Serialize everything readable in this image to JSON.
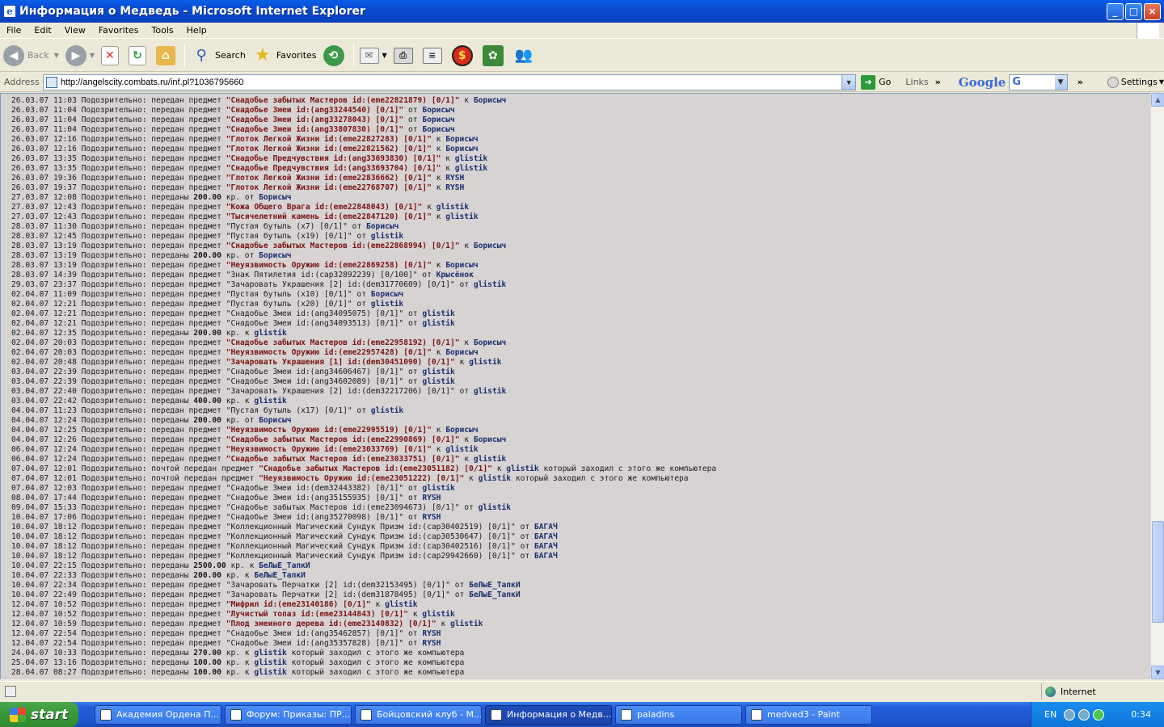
{
  "window": {
    "title": "Информация о Медведь - Microsoft Internet Explorer",
    "controls": [
      "_",
      "□",
      "×"
    ]
  },
  "menu": [
    "File",
    "Edit",
    "View",
    "Favorites",
    "Tools",
    "Help"
  ],
  "toolbar": {
    "back": "Back",
    "search": "Search",
    "favorites": "Favorites"
  },
  "address": {
    "label": "Address",
    "url": "http://angelscity.combats.ru/inf.pl?1036795660",
    "go": "Go",
    "links": "Links",
    "google": "Google",
    "google_select": "G",
    "settings": "Settings"
  },
  "log": [
    [
      [
        "26.03.07 11:03 Подозрительно: передан предмет ",
        "t"
      ],
      [
        "\"Снадобье забытых Мастеров id:(eme22821879) [0/1]\"",
        "i"
      ],
      [
        " к ",
        "t"
      ],
      [
        "Борисыч",
        "u"
      ]
    ],
    [
      [
        "26.03.07 11:04 Подозрительно: передан предмет ",
        "t"
      ],
      [
        "\"Снадобье Змеи id:(ang33244540) [0/1]\"",
        "i"
      ],
      [
        " от ",
        "t"
      ],
      [
        "Борисыч",
        "u"
      ]
    ],
    [
      [
        "26.03.07 11:04 Подозрительно: передан предмет ",
        "t"
      ],
      [
        "\"Снадобье Змеи id:(ang33278043) [0/1]\"",
        "i"
      ],
      [
        " от ",
        "t"
      ],
      [
        "Борисыч",
        "u"
      ]
    ],
    [
      [
        "26.03.07 11:04 Подозрительно: передан предмет ",
        "t"
      ],
      [
        "\"Снадобье Змеи id:(ang33807830) [0/1]\"",
        "i"
      ],
      [
        " от ",
        "t"
      ],
      [
        "Борисыч",
        "u"
      ]
    ],
    [
      [
        "26.03.07 12:16 Подозрительно: передан предмет ",
        "t"
      ],
      [
        "\"Глоток Легкой Жизни id:(eme22827283) [0/1]\"",
        "i"
      ],
      [
        " к ",
        "t"
      ],
      [
        "Борисыч",
        "u"
      ]
    ],
    [
      [
        "26.03.07 12:16 Подозрительно: передан предмет ",
        "t"
      ],
      [
        "\"Глоток Легкой Жизни id:(eme22821562) [0/1]\"",
        "i"
      ],
      [
        " к ",
        "t"
      ],
      [
        "Борисыч",
        "u"
      ]
    ],
    [
      [
        "26.03.07 13:35 Подозрительно: передан предмет ",
        "t"
      ],
      [
        "\"Снадобье Предчувствия id:(ang33693830) [0/1]\"",
        "i"
      ],
      [
        " к ",
        "t"
      ],
      [
        "glistik",
        "u"
      ]
    ],
    [
      [
        "26.03.07 13:35 Подозрительно: передан предмет ",
        "t"
      ],
      [
        "\"Снадобье Предчувствия id:(ang33693704) [0/1]\"",
        "i"
      ],
      [
        " к ",
        "t"
      ],
      [
        "glistik",
        "u"
      ]
    ],
    [
      [
        "26.03.07 19:36 Подозрительно: передан предмет ",
        "t"
      ],
      [
        "\"Глоток Легкой Жизни id:(eme22836662) [0/1]\"",
        "i"
      ],
      [
        " к ",
        "t"
      ],
      [
        "RYSH",
        "u"
      ]
    ],
    [
      [
        "26.03.07 19:37 Подозрительно: передан предмет ",
        "t"
      ],
      [
        "\"Глоток Легкой Жизни id:(eme22768707) [0/1]\"",
        "i"
      ],
      [
        " к ",
        "t"
      ],
      [
        "RYSH",
        "u"
      ]
    ],
    [
      [
        "27.03.07 12:08 Подозрительно: переданы ",
        "t"
      ],
      [
        "200.00",
        "n"
      ],
      [
        " кр. от ",
        "t"
      ],
      [
        "Борисыч",
        "u"
      ]
    ],
    [
      [
        "27.03.07 12:43 Подозрительно: передан предмет ",
        "t"
      ],
      [
        "\"Кожа Общего Врага id:(eme22848043) [0/1]\"",
        "i"
      ],
      [
        " к ",
        "t"
      ],
      [
        "glistik",
        "u"
      ]
    ],
    [
      [
        "27.03.07 12:43 Подозрительно: передан предмет ",
        "t"
      ],
      [
        "\"Тысячелетний камень id:(eme22847120) [0/1]\"",
        "i"
      ],
      [
        " к ",
        "t"
      ],
      [
        "glistik",
        "u"
      ]
    ],
    [
      [
        "28.03.07 11:30 Подозрительно: передан предмет ",
        "t"
      ],
      [
        "\"Пустая бутыль (x7) [0/1]\"",
        "t"
      ],
      [
        " от ",
        "t"
      ],
      [
        "Борисыч",
        "u"
      ]
    ],
    [
      [
        "28.03.07 12:45 Подозрительно: передан предмет ",
        "t"
      ],
      [
        "\"Пустая бутыль (x19) [0/1]\"",
        "t"
      ],
      [
        " от ",
        "t"
      ],
      [
        "glistik",
        "u"
      ]
    ],
    [
      [
        "28.03.07 13:19 Подозрительно: передан предмет ",
        "t"
      ],
      [
        "\"Снадобье забытых Мастеров id:(eme22868994) [0/1]\"",
        "i"
      ],
      [
        " к ",
        "t"
      ],
      [
        "Борисыч",
        "u"
      ]
    ],
    [
      [
        "28.03.07 13:19 Подозрительно: переданы ",
        "t"
      ],
      [
        "200.00",
        "n"
      ],
      [
        " кр. от ",
        "t"
      ],
      [
        "Борисыч",
        "u"
      ]
    ],
    [
      [
        "28.03.07 13:19 Подозрительно: передан предмет ",
        "t"
      ],
      [
        "\"Неуязвимость Оружию id:(eme22869258) [0/1]\"",
        "i"
      ],
      [
        " к ",
        "t"
      ],
      [
        "Борисыч",
        "u"
      ]
    ],
    [
      [
        "28.03.07 14:39 Подозрительно: передан предмет ",
        "t"
      ],
      [
        "\"Знак Пятилетия id:(cap32892239) [0/100]\"",
        "t"
      ],
      [
        " от ",
        "t"
      ],
      [
        "Крысёнок",
        "u"
      ]
    ],
    [
      [
        "29.03.07 23:37 Подозрительно: передан предмет ",
        "t"
      ],
      [
        "\"Зачаровать Украшения [2] id:(dem31770609) [0/1]\"",
        "t"
      ],
      [
        " от ",
        "t"
      ],
      [
        "glistik",
        "u"
      ]
    ],
    [
      [
        "02.04.07 11:09 Подозрительно: передан предмет ",
        "t"
      ],
      [
        "\"Пустая бутыль (x10) [0/1]\"",
        "t"
      ],
      [
        " от ",
        "t"
      ],
      [
        "Борисыч",
        "u"
      ]
    ],
    [
      [
        "02.04.07 12:21 Подозрительно: передан предмет ",
        "t"
      ],
      [
        "\"Пустая бутыль (x20) [0/1]\"",
        "t"
      ],
      [
        " от ",
        "t"
      ],
      [
        "glistik",
        "u"
      ]
    ],
    [
      [
        "02.04.07 12:21 Подозрительно: передан предмет ",
        "t"
      ],
      [
        "\"Снадобье Змеи id:(ang34095075) [0/1]\"",
        "t"
      ],
      [
        " от ",
        "t"
      ],
      [
        "glistik",
        "u"
      ]
    ],
    [
      [
        "02.04.07 12:21 Подозрительно: передан предмет ",
        "t"
      ],
      [
        "\"Снадобье Змеи id:(ang34093513) [0/1]\"",
        "t"
      ],
      [
        " от ",
        "t"
      ],
      [
        "glistik",
        "u"
      ]
    ],
    [
      [
        "02.04.07 12:35 Подозрительно: переданы ",
        "t"
      ],
      [
        "200.00",
        "n"
      ],
      [
        " кр. к ",
        "t"
      ],
      [
        "glistik",
        "u"
      ]
    ],
    [
      [
        "02.04.07 20:03 Подозрительно: передан предмет ",
        "t"
      ],
      [
        "\"Снадобье забытых Мастеров id:(eme22958192) [0/1]\"",
        "i"
      ],
      [
        " к ",
        "t"
      ],
      [
        "Борисыч",
        "u"
      ]
    ],
    [
      [
        "02.04.07 20:03 Подозрительно: передан предмет ",
        "t"
      ],
      [
        "\"Неуязвимость Оружию id:(eme22957428) [0/1]\"",
        "i"
      ],
      [
        " к ",
        "t"
      ],
      [
        "Борисыч",
        "u"
      ]
    ],
    [
      [
        "02.04.07 20:48 Подозрительно: передан предмет ",
        "t"
      ],
      [
        "\"Зачаровать Украшения [1] id:(dem30451090) [0/1]\"",
        "i"
      ],
      [
        " к ",
        "t"
      ],
      [
        "glistik",
        "u"
      ]
    ],
    [
      [
        "03.04.07 22:39 Подозрительно: передан предмет ",
        "t"
      ],
      [
        "\"Снадобье Змеи id:(ang34606467) [0/1]\"",
        "t"
      ],
      [
        " от ",
        "t"
      ],
      [
        "glistik",
        "u"
      ]
    ],
    [
      [
        "03.04.07 22:39 Подозрительно: передан предмет ",
        "t"
      ],
      [
        "\"Снадобье Змеи id:(ang34602089) [0/1]\"",
        "t"
      ],
      [
        " от ",
        "t"
      ],
      [
        "glistik",
        "u"
      ]
    ],
    [
      [
        "03.04.07 22:40 Подозрительно: передан предмет ",
        "t"
      ],
      [
        "\"Зачаровать Украшения [2] id:(dem32217206) [0/1]\"",
        "t"
      ],
      [
        " от ",
        "t"
      ],
      [
        "glistik",
        "u"
      ]
    ],
    [
      [
        "03.04.07 22:42 Подозрительно: переданы ",
        "t"
      ],
      [
        "400.00",
        "n"
      ],
      [
        " кр. к ",
        "t"
      ],
      [
        "glistik",
        "u"
      ]
    ],
    [
      [
        "04.04.07 11:23 Подозрительно: передан предмет ",
        "t"
      ],
      [
        "\"Пустая бутыль (x17) [0/1]\"",
        "t"
      ],
      [
        " от ",
        "t"
      ],
      [
        "glistik",
        "u"
      ]
    ],
    [
      [
        "04.04.07 12:24 Подозрительно: переданы ",
        "t"
      ],
      [
        "200.00",
        "n"
      ],
      [
        " кр. от ",
        "t"
      ],
      [
        "Борисыч",
        "u"
      ]
    ],
    [
      [
        "04.04.07 12:25 Подозрительно: передан предмет ",
        "t"
      ],
      [
        "\"Неуязвимость Оружию id:(eme22995519) [0/1]\"",
        "i"
      ],
      [
        " к ",
        "t"
      ],
      [
        "Борисыч",
        "u"
      ]
    ],
    [
      [
        "04.04.07 12:26 Подозрительно: передан предмет ",
        "t"
      ],
      [
        "\"Снадобье забытых Мастеров id:(eme22990869) [0/1]\"",
        "i"
      ],
      [
        " к ",
        "t"
      ],
      [
        "Борисыч",
        "u"
      ]
    ],
    [
      [
        "06.04.07 12:24 Подозрительно: передан предмет ",
        "t"
      ],
      [
        "\"Неуязвимость Оружию id:(eme23033769) [0/1]\"",
        "i"
      ],
      [
        " к ",
        "t"
      ],
      [
        "glistik",
        "u"
      ]
    ],
    [
      [
        "06.04.07 12:24 Подозрительно: передан предмет ",
        "t"
      ],
      [
        "\"Снадобье забытых Мастеров id:(eme23033751) [0/1]\"",
        "i"
      ],
      [
        " к ",
        "t"
      ],
      [
        "glistik",
        "u"
      ]
    ],
    [
      [
        "07.04.07 12:01 Подозрительно: почтой передан предмет ",
        "t"
      ],
      [
        "\"Снадобье забытых Мастеров id:(eme23051182) [0/1]\"",
        "i"
      ],
      [
        " к ",
        "t"
      ],
      [
        "glistik",
        "u"
      ],
      [
        " который заходил с этого же компьютера",
        "t"
      ]
    ],
    [
      [
        "07.04.07 12:01 Подозрительно: почтой передан предмет ",
        "t"
      ],
      [
        "\"Неуязвимость Оружию id:(eme23051222) [0/1]\"",
        "i"
      ],
      [
        " к ",
        "t"
      ],
      [
        "glistik",
        "u"
      ],
      [
        " который заходил с этого же компьютера",
        "t"
      ]
    ],
    [
      [
        "07.04.07 12:03 Подозрительно: передан предмет ",
        "t"
      ],
      [
        "\"Снадобье Змеи id:(dem32443382) [0/1]\"",
        "t"
      ],
      [
        " от ",
        "t"
      ],
      [
        "glistik",
        "u"
      ]
    ],
    [
      [
        "08.04.07 17:44 Подозрительно: передан предмет ",
        "t"
      ],
      [
        "\"Снадобье Змеи id:(ang35155935) [0/1]\"",
        "t"
      ],
      [
        " от ",
        "t"
      ],
      [
        "RYSH",
        "u"
      ]
    ],
    [
      [
        "09.04.07 15:33 Подозрительно: передан предмет ",
        "t"
      ],
      [
        "\"Снадобье забытых Мастеров id:(eme23094673) [0/1]\"",
        "t"
      ],
      [
        " от ",
        "t"
      ],
      [
        "glistik",
        "u"
      ]
    ],
    [
      [
        "10.04.07 17:06 Подозрительно: передан предмет ",
        "t"
      ],
      [
        "\"Снадобье Змеи id:(ang35270098) [0/1]\"",
        "t"
      ],
      [
        " от ",
        "t"
      ],
      [
        "RYSH",
        "u"
      ]
    ],
    [
      [
        "10.04.07 18:12 Подозрительно: передан предмет ",
        "t"
      ],
      [
        "\"Коллекционный Магический Сундук Призм id:(cap30402519) [0/1]\"",
        "t"
      ],
      [
        " от ",
        "t"
      ],
      [
        "БАГАЧ",
        "u"
      ]
    ],
    [
      [
        "10.04.07 18:12 Подозрительно: передан предмет ",
        "t"
      ],
      [
        "\"Коллекционный Магический Сундук Призм id:(cap30530647) [0/1]\"",
        "t"
      ],
      [
        " от ",
        "t"
      ],
      [
        "БАГАЧ",
        "u"
      ]
    ],
    [
      [
        "10.04.07 18:12 Подозрительно: передан предмет ",
        "t"
      ],
      [
        "\"Коллекционный Магический Сундук Призм id:(cap30402516) [0/1]\"",
        "t"
      ],
      [
        " от ",
        "t"
      ],
      [
        "БАГАЧ",
        "u"
      ]
    ],
    [
      [
        "10.04.07 18:12 Подозрительно: передан предмет ",
        "t"
      ],
      [
        "\"Коллекционный Магический Сундук Призм id:(cap29942660) [0/1]\"",
        "t"
      ],
      [
        " от ",
        "t"
      ],
      [
        "БАГАЧ",
        "u"
      ]
    ],
    [
      [
        "10.04.07 22:15 Подозрительно: переданы ",
        "t"
      ],
      [
        "2500.00",
        "n"
      ],
      [
        " кр. к ",
        "t"
      ],
      [
        "БеЛыЕ_ТапкИ",
        "u"
      ]
    ],
    [
      [
        "10.04.07 22:33 Подозрительно: переданы ",
        "t"
      ],
      [
        "200.00",
        "n"
      ],
      [
        " кр. к ",
        "t"
      ],
      [
        "БеЛыЕ_ТапкИ",
        "u"
      ]
    ],
    [
      [
        "10.04.07 22:34 Подозрительно: передан предмет ",
        "t"
      ],
      [
        "\"Зачаровать Перчатки [2] id:(dem32153495) [0/1]\"",
        "t"
      ],
      [
        " от ",
        "t"
      ],
      [
        "БеЛыЕ_ТапкИ",
        "u"
      ]
    ],
    [
      [
        "10.04.07 22:49 Подозрительно: передан предмет ",
        "t"
      ],
      [
        "\"Зачаровать Перчатки [2] id:(dem31878495) [0/1]\"",
        "t"
      ],
      [
        " от ",
        "t"
      ],
      [
        "БеЛыЕ_ТапкИ",
        "u"
      ]
    ],
    [
      [
        "12.04.07 10:52 Подозрительно: передан предмет ",
        "t"
      ],
      [
        "\"Мифрил id:(eme23140186) [0/1]\"",
        "i"
      ],
      [
        " к ",
        "t"
      ],
      [
        "glistik",
        "u"
      ]
    ],
    [
      [
        "12.04.07 10:52 Подозрительно: передан предмет ",
        "t"
      ],
      [
        "\"Лучистый топаз id:(eme23144843) [0/1]\"",
        "i"
      ],
      [
        " к ",
        "t"
      ],
      [
        "glistik",
        "u"
      ]
    ],
    [
      [
        "12.04.07 10:59 Подозрительно: передан предмет ",
        "t"
      ],
      [
        "\"Плод змеиного дерева id:(eme23140832) [0/1]\"",
        "i"
      ],
      [
        " к ",
        "t"
      ],
      [
        "glistik",
        "u"
      ]
    ],
    [
      [
        "12.04.07 22:54 Подозрительно: передан предмет ",
        "t"
      ],
      [
        "\"Снадобье Змеи id:(ang35462857) [0/1]\"",
        "t"
      ],
      [
        " от ",
        "t"
      ],
      [
        "RYSH",
        "u"
      ]
    ],
    [
      [
        "12.04.07 22:54 Подозрительно: передан предмет ",
        "t"
      ],
      [
        "\"Снадобье Змеи id:(ang35357828) [0/1]\"",
        "t"
      ],
      [
        " от ",
        "t"
      ],
      [
        "RYSH",
        "u"
      ]
    ],
    [
      [
        "24.04.07 10:33 Подозрительно: переданы ",
        "t"
      ],
      [
        "270.00",
        "n"
      ],
      [
        " кр. к ",
        "t"
      ],
      [
        "glistik",
        "u"
      ],
      [
        " который заходил с этого же компьютера",
        "t"
      ]
    ],
    [
      [
        "25.04.07 13:16 Подозрительно: переданы ",
        "t"
      ],
      [
        "100.00",
        "n"
      ],
      [
        " кр. к ",
        "t"
      ],
      [
        "glistik",
        "u"
      ],
      [
        " который заходил с этого же компьютера",
        "t"
      ]
    ],
    [
      [
        "28.04.07 08:27 Подозрительно: переданы ",
        "t"
      ],
      [
        "100.00",
        "n"
      ],
      [
        " кр. к ",
        "t"
      ],
      [
        "glistik",
        "u"
      ],
      [
        " который заходил с этого же компьютера",
        "t"
      ]
    ]
  ],
  "status": {
    "zone": "Internet"
  },
  "taskbar": {
    "start": "start",
    "tasks": [
      {
        "label": "Академия Ордена П...",
        "active": false
      },
      {
        "label": "Форум: Приказы: ПР...",
        "active": false
      },
      {
        "label": "Бойцовский клуб - М...",
        "active": false
      },
      {
        "label": "Информация о Медв...",
        "active": true
      },
      {
        "label": "paladins",
        "active": false
      },
      {
        "label": "medved3 - Paint",
        "active": false
      }
    ],
    "lang": "EN",
    "clock": "0:34"
  },
  "colors": {
    "item": "#7a1414",
    "user": "#1a2f6e",
    "page_bg": "#d7d3d3"
  }
}
